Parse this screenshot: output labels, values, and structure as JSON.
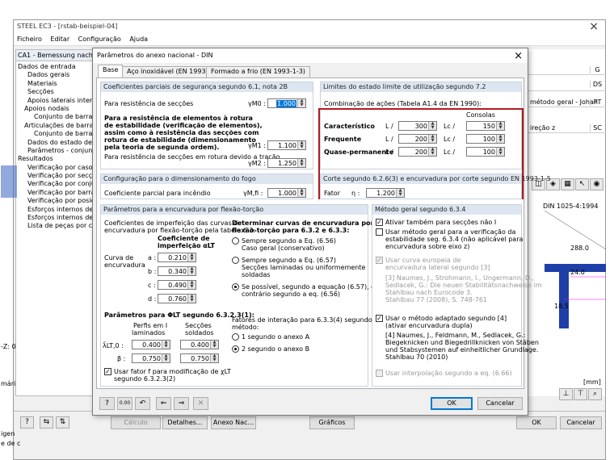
{
  "app": {
    "title": "STEEL EC3 - [rstab-beispiel-04]",
    "menu": [
      "Ficheiro",
      "Editar",
      "Configuração",
      "Ajuda"
    ],
    "left_panel_header": "CA1 - Bemessung nach Euroco",
    "tree": [
      "Dados de entrada",
      "Dados gerais",
      "Materiais",
      "Secções",
      "Apoios laterais intermédi",
      "Apoios nodais",
      "Conjunto de barras n",
      "Articulações de barra",
      "Conjunto de barras n",
      "Dados do estado de utili",
      "Parâmetros - conjuntos d",
      "Resultados",
      "Verificação por caso de",
      "Verificação por secção",
      "Verificação por conjunto",
      "Verificação por barra",
      "Verificação por posição x",
      "Esforços internos determ",
      "Esforços internos determ",
      "Lista de peças por conjur"
    ],
    "right_cells": {
      "g": "G",
      "ds": "DS",
      "pt_label": "método geral - Johan",
      "pt": "PT",
      "sc_label": "ireção z",
      "sc": "SC",
      "norm": "DIN 1025-4:1994",
      "dim1": "288.0",
      "dim2": "24.0",
      "dim3": "18.5",
      "unit": "[mm]"
    },
    "left_edge_text": "-Z: 0",
    "left_edge_text2": "mári",
    "left_edge_text3": "e de c",
    "left_edge_text4": "igen",
    "bottom_buttons": {
      "calc": "Cálculo",
      "details": "Detalhes...",
      "annex": "Anexo Nac...",
      "graphics": "Gráficos",
      "ok": "OK",
      "cancel": "Cancelar"
    }
  },
  "dialog": {
    "title": "Parâmetros do anexo nacional - DIN",
    "tabs": [
      "Base",
      "Aço inoxidável (EN 1993-1-4)",
      "Formado a frio (EN 1993-1-3)"
    ],
    "g1": {
      "header": "Coeficientes parciais de segurança segundo 6.1, nota 2B",
      "r1": "Para resistência de secções",
      "r1_sym": "γM0 :",
      "r1_val": "1.000",
      "r2a": "Para a resistência de elementos à rotura",
      "r2b": "de estabilidade (verificação de elementos),",
      "r2c": "assim como à resistência das secções com",
      "r2d": "rotura de estabilidade (dimensionamento",
      "r2e": "pela teoria de segunda ordem).",
      "r2_sym": "γM1 :",
      "r2_val": "1.100",
      "r3": "Para resistência de secções em rotura devido a tração",
      "r3_sym": "γM2 :",
      "r3_val": "1.250"
    },
    "g2": {
      "header": "Limites do estado limite de utilização segundo 7.2",
      "combo": "Combinação de ações (Tabela A1.4 da EN 1990):",
      "consolas": "Consolas",
      "rows": [
        {
          "label": "Característico",
          "l": "L /",
          "lv": "300",
          "lc": "Lc /",
          "lcv": "150"
        },
        {
          "label": "Frequente",
          "l": "L /",
          "lv": "200",
          "lc": "Lc /",
          "lcv": "100"
        },
        {
          "label": "Quase-permanente",
          "l": "L /",
          "lv": "200",
          "lc": "Lc /",
          "lcv": "100"
        }
      ]
    },
    "g3": {
      "header": "Configuração para o dimensionamento do fogo",
      "label": "Coeficiente parcial para incêndio",
      "sym": "γM,fi :",
      "val": "1.000"
    },
    "g4": {
      "header": "Corte segundo 6.2.6(3) e encurvadura por corte segundo EN 1993-1-5",
      "label": "Fator",
      "sym": "η :",
      "val": "1.200"
    },
    "g5": {
      "header": "Parâmetros para a encurvadura por flexão-torção",
      "c1": "Coeficientes de imperfeição das curvas de",
      "c2": "encurvadura por flexão-torção pela tabela 6.3:",
      "coef1": "Coeficiente de",
      "coef2": "imperfeição αLT",
      "curve1": "Curva de",
      "curve2": "encurvadura",
      "curves": [
        {
          "k": "a :",
          "v": "0.210"
        },
        {
          "k": "b :",
          "v": "0.340"
        },
        {
          "k": "c :",
          "v": "0.490"
        },
        {
          "k": "d :",
          "v": "0.760"
        }
      ],
      "phi": "Parâmetros para ΦLT segundo 6.3.2.3(1):",
      "profiles1": "Perfis em I",
      "profiles2": "laminados",
      "sections1": "Secções",
      "sections2": "soldados",
      "lam_sym": "λ̄LT,0 :",
      "lam_v1": "0.400",
      "lam_v2": "0.400",
      "beta_sym": "β :",
      "beta_v1": "0.750",
      "beta_v2": "0.750",
      "f1": "Usar fator f para modificação de χLT",
      "f2": "segundo 6.3.2.3(2)",
      "det1": "Determinar curvas de encurvadura por",
      "det2": "flexão-torção para 6.3.2 e 6.3.3:",
      "o1a": "Sempre segundo a Eq. (6.56)",
      "o1b": "Caso geral (conservativo)",
      "o2a": "Sempre segundo a Eq. (6.57)",
      "o2b": "Secções laminadas ou uniformemente",
      "o2c": "soldadas",
      "o3a": "Se possível, segundo a equação (6.57), caso",
      "o3b": "contrário segundo a eq. (6.56)",
      "fat1": "Fatores de interação para 6.3.3(4) segundo o",
      "fat2": "método:",
      "m1": "1 segundo o anexo A",
      "m2": "2 segundo o anexo B"
    },
    "g6": {
      "header": "Método geral segundo 6.3.4",
      "a1": "Ativar também para secções não I",
      "a2a": "Usar método geral para a verificação da",
      "a2b": "estabilidade seg. 6.3.4 (não aplicável para",
      "a2c": "encurvadura sobre eixo z)",
      "a3a": "Usar curva europeia de",
      "a3b": "encurvadura lateral segundo [3]",
      "ref3a": "[3] Naumes, J., Strohmann, I., Ungermann, D.,",
      "ref3b": "Sedlacek, G.: Die neuen Stabilitätsnachweise im",
      "ref3c": "Stahlbau nach Eurocode 3.",
      "ref3d": "Stahlbau 77 (2008), S. 748-761",
      "a4a": "Usar o método adaptado segundo [4]",
      "a4b": "(ativar encurvadura dupla)",
      "ref4a": "[4] Naumes, J., Feldmann, M., Sedlacek, G.:",
      "ref4b": "Biegeknicken und Biegedrillknicken von Stäben",
      "ref4c": "und Stabsystemen auf einheitlicher Grundlage.",
      "ref4d": "Stahlbau 70 (2010)",
      "a5": "Usar interpolação segundo a eq. (6.66)"
    },
    "ok": "OK",
    "cancel": "Cancelar",
    "icon_zero": "0.00"
  }
}
